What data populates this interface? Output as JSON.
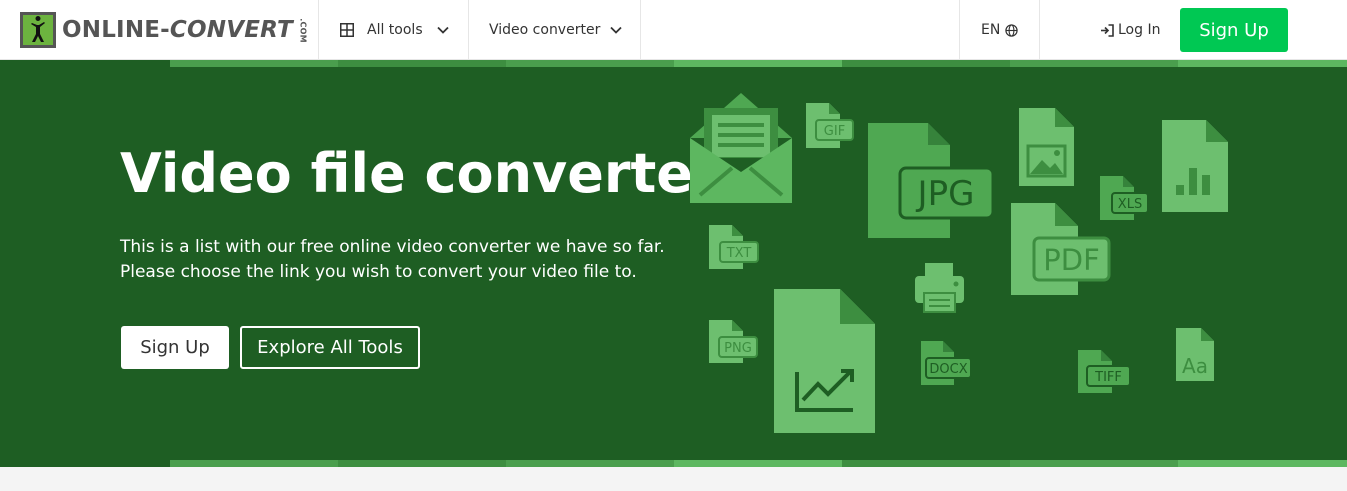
{
  "header": {
    "logo_text_a": "ONLINE-",
    "logo_text_b": "CONVERT",
    "logo_text_c": ".COM",
    "all_tools": "All tools",
    "video_converter": "Video converter",
    "lang": "EN",
    "login": "Log In",
    "signup": "Sign Up"
  },
  "hero": {
    "title": "Video file converter",
    "description": "This is a list with our free online video converter we have so far. Please choose the link you wish to convert your video file to.",
    "signup_label": "Sign Up",
    "explore_label": "Explore All Tools"
  },
  "file_icons": {
    "gif": "GIF",
    "jpg": "JPG",
    "xls": "XLS",
    "txt": "TXT",
    "pdf": "PDF",
    "png": "PNG",
    "docx": "DOCX",
    "tiff": "TIFF",
    "font": "Aa"
  },
  "colors": {
    "hero_bg": "#1e5e23",
    "accent": "#00c853",
    "icon_light": "#6dbf6f",
    "icon_mid": "#4fa852"
  }
}
